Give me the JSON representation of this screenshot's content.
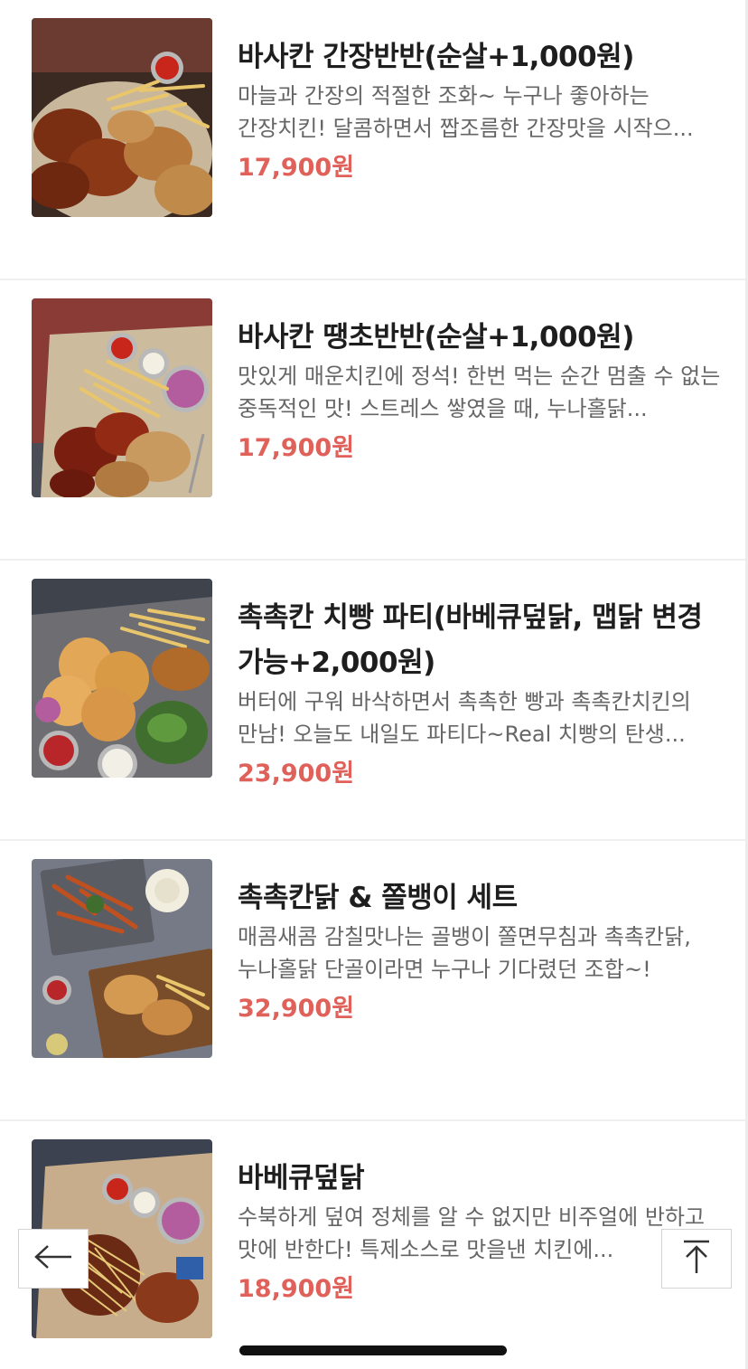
{
  "menu": {
    "items": [
      {
        "name": "바사칸 간장반반(순살+1,000원)",
        "description": "마늘과 간장의 적절한 조화~ 누구나 좋아하는 간장치킨! 달콤하면서 짭조름한 간장맛을 시작으...",
        "price": "17,900원",
        "image": "soy-chicken-platter-photo"
      },
      {
        "name": "바사칸 땡초반반(순살+1,000원)",
        "description": "맛있게 매운치킨에 정석! 한번 먹는 순간 멈출 수 없는 중독적인 맛! 스트레스 쌓였을 때, 누나홀닭...",
        "price": "17,900원",
        "image": "spicy-chicken-platter-photo"
      },
      {
        "name": "촉촉칸 치빵 파티(바베큐덮닭, 맵닭 변경 가능+2,000원)",
        "description": "버터에 구워 바삭하면서 촉촉한 빵과 촉촉칸치킨의 만남! 오늘도 내일도 파티다~Real 치빵의 탄생...",
        "price": "23,900원",
        "image": "chicken-bread-party-photo"
      },
      {
        "name": "촉촉칸닭 & 쫄뱅이 세트",
        "description": "매콤새콤 감칠맛나는 골뱅이 쫄면무침과 촉촉칸닭, 누나홀닭 단골이라면 누구나 기다렸던 조합~!",
        "price": "32,900원",
        "image": "chicken-whelk-set-photo"
      },
      {
        "name": "바베큐덮닭",
        "description": "수북하게 덮여 정체를 알 수 없지만 비주얼에 반하고 맛에 반한다! 특제소스로 맛을낸 치킨에...",
        "price": "18,900원",
        "image": "bbq-covered-chicken-photo"
      }
    ]
  },
  "controls": {
    "back_icon": "arrow-left-icon",
    "top_icon": "arrow-up-to-top-icon"
  },
  "colors": {
    "price": "#e0605a",
    "title": "#1e1e1e",
    "description": "#666666",
    "divider": "#f0f0f0"
  }
}
